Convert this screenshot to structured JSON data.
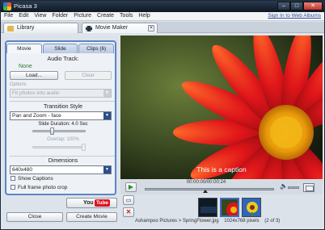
{
  "window": {
    "title": "Picasa 3",
    "controls": {
      "minimize": "–",
      "maximize": "□",
      "close": "✕"
    }
  },
  "menu": {
    "items": [
      "File",
      "Edit",
      "View",
      "Folder",
      "Picture",
      "Create",
      "Tools",
      "Help"
    ],
    "sign_in": "Sign In to Web Albums"
  },
  "tabs": [
    {
      "label": "Library",
      "icon": "folder-icon"
    },
    {
      "label": "Movie Maker",
      "icon": "film-icon",
      "closable": true
    }
  ],
  "left_panel": {
    "tabs": [
      "Movie",
      "Slide",
      "Clips (6)"
    ],
    "active_tab": "Movie",
    "audio": {
      "title": "Audio Track:",
      "value": "None",
      "load_label": "Load...",
      "clear_label": "Clear",
      "options_label": "Options",
      "options_value": "Fit photos into audio"
    },
    "transition": {
      "title": "Transition Style",
      "value": "Pan and Zoom - face",
      "slide_duration_label": "Slide Duration: 4.0 Sec",
      "slide_duration_seconds": 4.0,
      "overlap_label": "Overlap: 100%",
      "overlap_percent": 100
    },
    "dimensions": {
      "title": "Dimensions",
      "value": "640x480",
      "show_captions_label": "Show Captions",
      "full_frame_label": "Full frame photo crop"
    },
    "buttons": {
      "youtube_you": "You",
      "youtube_tube": "Tube",
      "close": "Close",
      "create": "Create Movie"
    }
  },
  "player": {
    "caption": "This is a caption",
    "timecode": "00:00:00/00:00:24",
    "progress_fraction": 0.47
  },
  "filmstrip": {
    "status": {
      "path": "Ashampoo Pictures > SpringFlower.jpg",
      "size": "1024x768 pixels",
      "index": "(2 of 3)"
    }
  },
  "icons": {
    "app": "picasa-icon",
    "play": "play-icon",
    "volume": "volume-icon",
    "fullscreen": "fullscreen-icon",
    "add": "add-to-movie-icon",
    "delete": "delete-icon"
  },
  "colors": {
    "panel_border": "#5c85c4",
    "accent": "#2c4f8a",
    "youtube_red": "#d12"
  }
}
